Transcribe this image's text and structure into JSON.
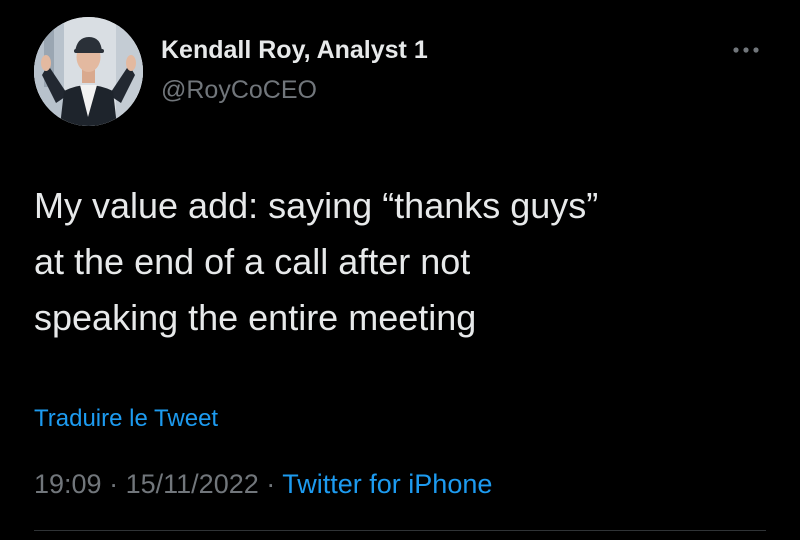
{
  "author": {
    "display_name": "Kendall Roy, Analyst 1",
    "handle": "@RoyCoCEO",
    "avatar_icon": "profile-photo"
  },
  "tweet": {
    "lines": [
      "My value add: saying “thanks guys”",
      "at the end of a call after not",
      "speaking the entire meeting"
    ],
    "translate_label": "Traduire le Tweet",
    "time": "19:09",
    "date": "15/11/2022",
    "separator": "·",
    "source": "Twitter for iPhone"
  },
  "menu": {
    "icon": "more-options-icon"
  },
  "colors": {
    "background": "#000000",
    "text": "#e7e9ea",
    "secondary": "#71767b",
    "accent": "#1d9bf0",
    "divider": "#2f3336"
  }
}
